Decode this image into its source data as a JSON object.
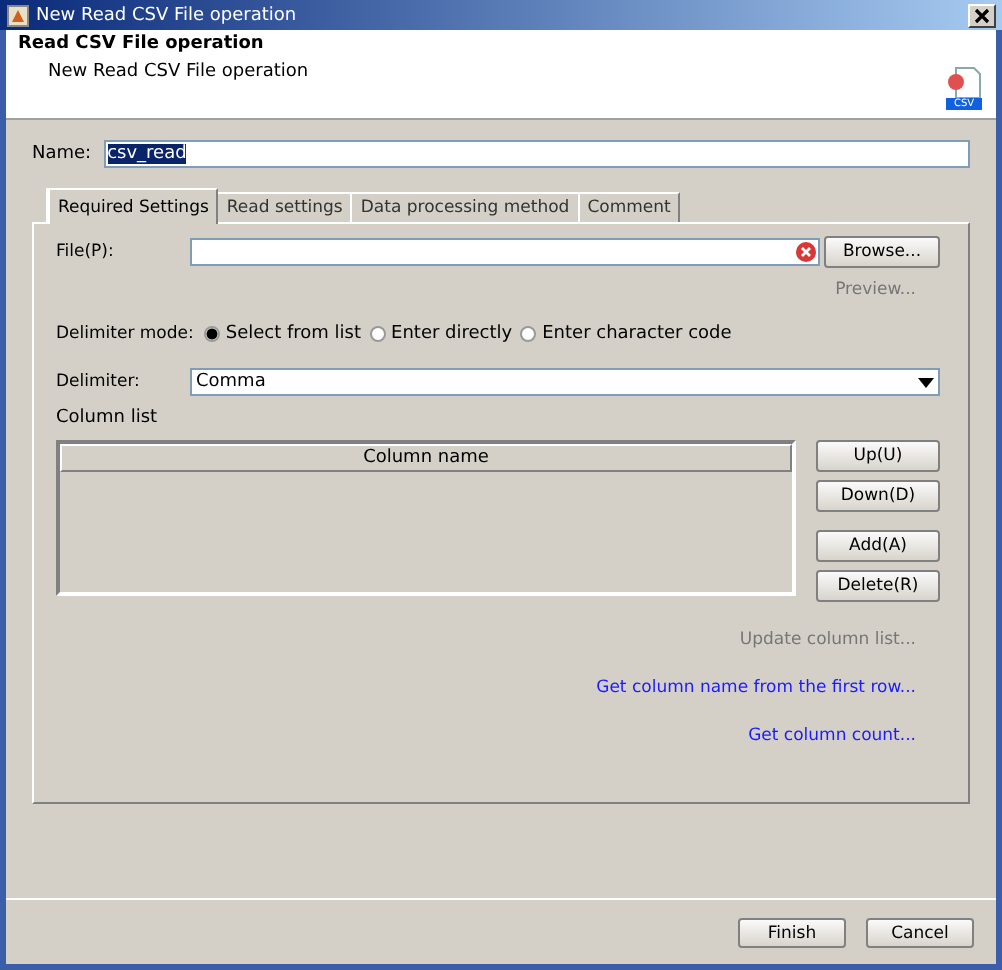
{
  "window": {
    "title": "New Read CSV File operation"
  },
  "header": {
    "title": "Read CSV File operation",
    "subtitle": "New Read CSV File operation",
    "icon_label": "CSV"
  },
  "name_field": {
    "label": "Name:",
    "value": "csv_read"
  },
  "tabs": [
    {
      "label": "Required Settings",
      "selected": true
    },
    {
      "label": "Read settings",
      "selected": false
    },
    {
      "label": "Data processing method",
      "selected": false
    },
    {
      "label": "Comment",
      "selected": false
    }
  ],
  "file": {
    "label": "File(P):",
    "browse": "Browse...",
    "preview": "Preview...",
    "preview_disabled": true
  },
  "delimiter_mode": {
    "label": "Delimiter mode:",
    "options": [
      {
        "label": "Select from list",
        "selected": true
      },
      {
        "label": "Enter directly",
        "selected": false
      },
      {
        "label": "Enter character code",
        "selected": false
      }
    ]
  },
  "delimiter": {
    "label": "Delimiter:",
    "value": "Comma"
  },
  "column_list": {
    "label": "Column list",
    "columns": [
      "Column name"
    ],
    "buttons": [
      "Up(U)",
      "Down(D)",
      "Add(A)",
      "Delete(R)"
    ]
  },
  "links": [
    {
      "label": "Update column list...",
      "disabled": true
    },
    {
      "label": "Get column name from the first row...",
      "disabled": false
    },
    {
      "label": "Get column count...",
      "disabled": false
    }
  ],
  "buttons": [
    "Finish",
    "Cancel"
  ]
}
